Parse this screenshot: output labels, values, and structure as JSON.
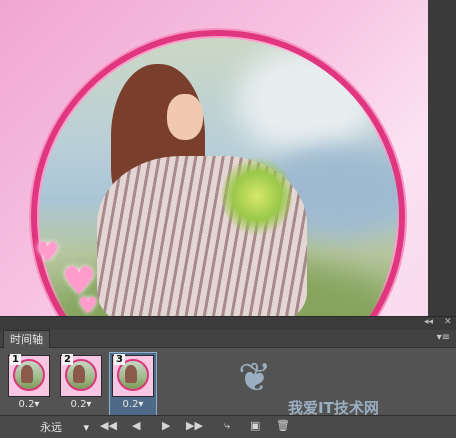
{
  "panel": {
    "collapse_glyph": "◂◂",
    "close_glyph": "✕",
    "tab_label": "时间轴",
    "menu_glyph": "▾≡"
  },
  "frames": [
    {
      "number": "1",
      "delay": "0.2▾",
      "selected": false
    },
    {
      "number": "2",
      "delay": "0.2▾",
      "selected": false
    },
    {
      "number": "3",
      "delay": "0.2▾",
      "selected": true
    }
  ],
  "bottom": {
    "loop_value": "永远",
    "loop_arrow": "▾",
    "first_frame": "◀◀",
    "prev_frame": "◀",
    "play": "▶",
    "next_frame": "▶▶",
    "tween": "⤷",
    "duplicate": "▣",
    "delete": "🗑"
  },
  "watermark": "我爱IT技术网",
  "colors": {
    "frame_ring": "#e0357f",
    "panel_bg": "#535353",
    "selected_frame": "#4e6a86"
  }
}
